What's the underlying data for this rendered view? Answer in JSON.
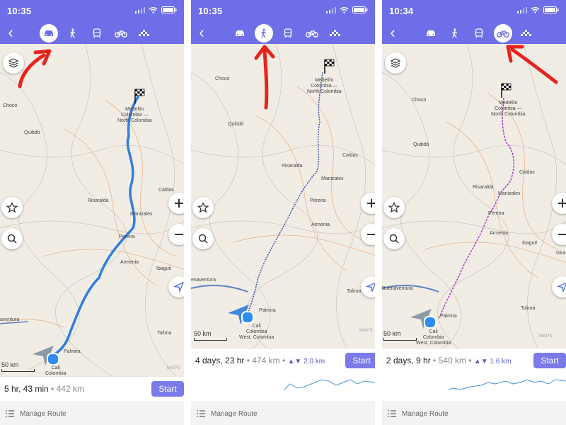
{
  "panels": [
    {
      "status_time": "10:35",
      "active_mode": "car",
      "modes": [
        "car-icon",
        "walk-icon",
        "train-icon",
        "bike-icon",
        "taxi-icon"
      ],
      "summary": {
        "duration": "5 hr, 43 min",
        "distance": "442 km",
        "elevation": ""
      },
      "start_label": "Start",
      "manage_label": "Manage Route",
      "scale_label": "50 km",
      "route_color": "#2f7fe0",
      "map_labels": {
        "choco": "Chocó",
        "quibdo": "Quibdó",
        "medellin": "Medellín\nColombia —\nNorth Colombia",
        "risaralda": "Risaralda",
        "caldas": "Caldas",
        "manizales": "Manizales",
        "pereira": "Pereira",
        "armenia": "Armenia",
        "ibague": "Ibagué",
        "tolima": "Tolima",
        "buenaventura": "aventura",
        "palmira": "Palmira",
        "cali": "Cali\nColombia"
      },
      "maps_credit": "MAPS"
    },
    {
      "status_time": "10:35",
      "active_mode": "walk",
      "modes": [
        "car-icon",
        "walk-icon",
        "train-icon",
        "bike-icon",
        "taxi-icon"
      ],
      "summary": {
        "duration": "4 days, 23 hr",
        "distance": "474 km",
        "elevation": "▲▼ 2.0 km"
      },
      "start_label": "Start",
      "manage_label": "Manage Route",
      "scale_label": "50 km",
      "route_color": "#3a4fa8",
      "map_labels": {
        "choco": "Chocó",
        "quibdo": "Quibdó",
        "medellin": "Medellín\nColombia —\nNorth Colombia",
        "risaralda": "Risaralda",
        "caldas": "Caldas",
        "manizales": "Manizales",
        "pereira": "Pereira",
        "armenia": "Armenia",
        "tolima": "Tolima",
        "buenaventura": "enaventura",
        "palmira": "Palmira",
        "cali": "Cali\nColombia\nWest, Colombia"
      },
      "maps_credit": "MAPS"
    },
    {
      "status_time": "10:34",
      "active_mode": "bike",
      "modes": [
        "car-icon",
        "walk-icon",
        "train-icon",
        "bike-icon",
        "taxi-icon"
      ],
      "summary": {
        "duration": "2 days, 9 hr",
        "distance": "540 km",
        "elevation": "▲▼ 1.6 km"
      },
      "start_label": "Start",
      "manage_label": "Manage Route",
      "scale_label": "50 km",
      "route_color": "#b03cc8",
      "map_labels": {
        "choco": "Chocó",
        "quibdo": "Quibdó",
        "medellin": "Medellín\nColombia —\nNorth Colombia",
        "risaralda": "Risaralda",
        "caldas": "Caldas",
        "manizales": "Manizales",
        "pereira": "Pereira",
        "armenia": "Armenia",
        "ibague": "Ibagué",
        "tolima": "Tolima",
        "girardot": "Gira",
        "buenaventura": "Buenaventura",
        "palmira": "Palmira",
        "cali": "Cali\nColombia\nWest, Colombia"
      },
      "maps_credit": "MAPS"
    }
  ],
  "colors": {
    "header": "#6e6ee8",
    "start_button": "#7a7ae8",
    "annotation_arrow": "#e8231e",
    "location_dot": "#2e8df0"
  },
  "separator": ""
}
